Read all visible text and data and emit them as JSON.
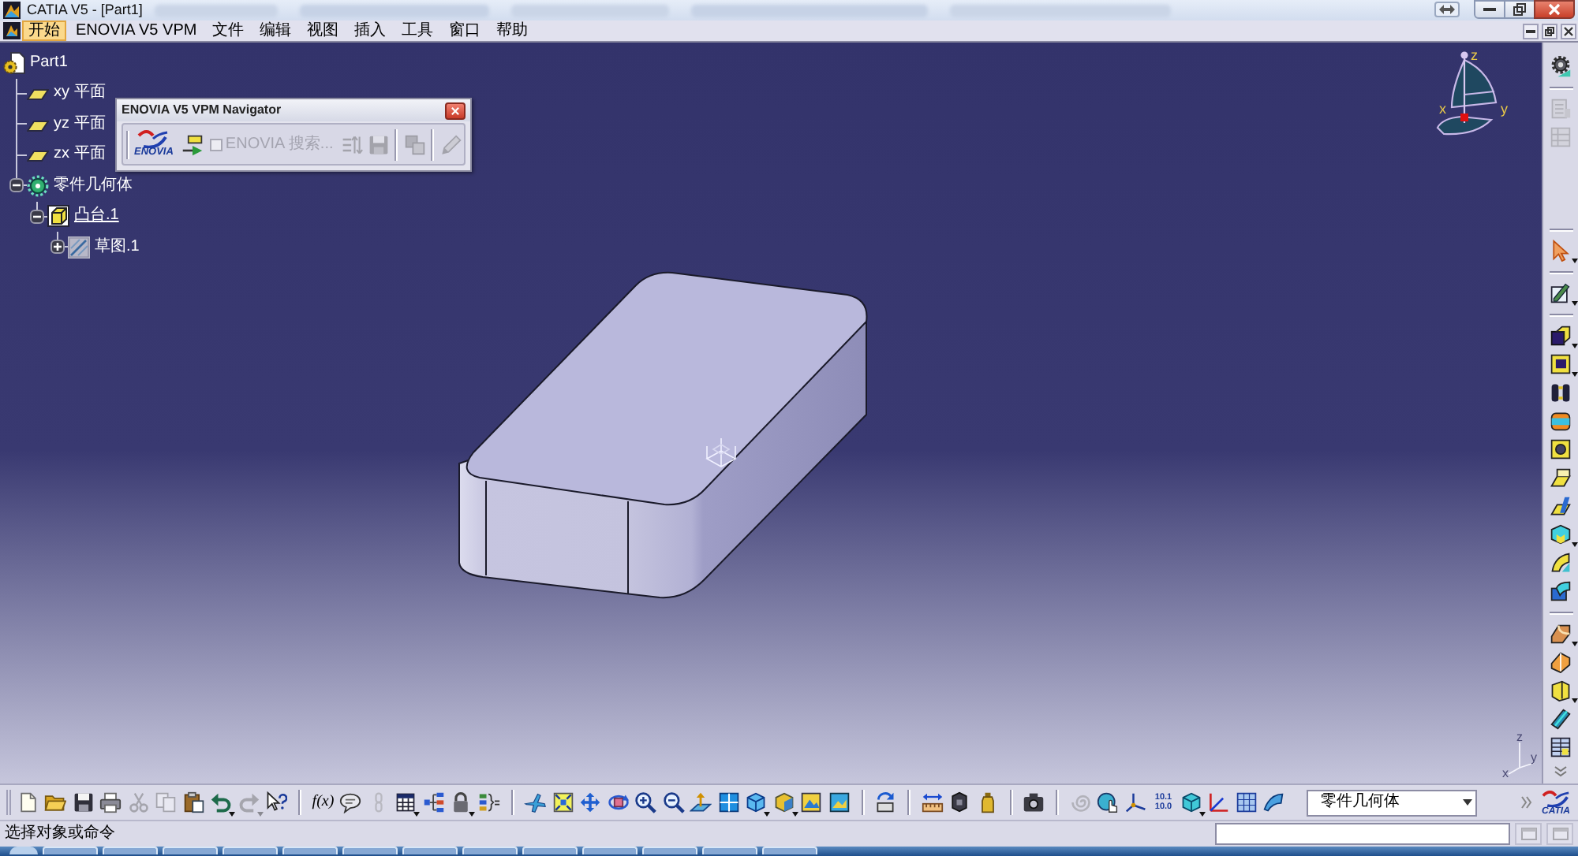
{
  "title_bar": {
    "title": "CATIA V5 - [Part1]"
  },
  "menu_bar": {
    "items": [
      {
        "label": "开始",
        "selected": true
      },
      {
        "label": "ENOVIA V5 VPM",
        "selected": false
      },
      {
        "label": "文件",
        "selected": false
      },
      {
        "label": "编辑",
        "selected": false
      },
      {
        "label": "视图",
        "selected": false
      },
      {
        "label": "插入",
        "selected": false
      },
      {
        "label": "工具",
        "selected": false
      },
      {
        "label": "窗口",
        "selected": false
      },
      {
        "label": "帮助",
        "selected": false
      }
    ]
  },
  "specification_tree": {
    "root": {
      "label": "Part1",
      "kind": "part",
      "in_work": false,
      "children": [
        {
          "label": "xy 平面",
          "kind": "plane",
          "in_work": false
        },
        {
          "label": "yz 平面",
          "kind": "plane",
          "in_work": false
        },
        {
          "label": "zx 平面",
          "kind": "plane",
          "in_work": false
        },
        {
          "label": "零件几何体",
          "kind": "body",
          "in_work": false,
          "expanded": true,
          "children": [
            {
              "label": "凸台.1",
              "kind": "pad",
              "in_work": true,
              "expanded": true,
              "children": [
                {
                  "label": "草图.1",
                  "kind": "sketch",
                  "in_work": false,
                  "expanded": false
                }
              ]
            }
          ]
        }
      ]
    }
  },
  "navigator": {
    "title": "ENOVIA V5 VPM Navigator",
    "logo_text": "ENOVIA",
    "groups": [
      {
        "items": [
          {
            "kind": "connect",
            "disabled": false
          },
          {
            "kind": "checkbox",
            "label": "ENOVIA 搜索...",
            "checked": false,
            "disabled": true
          },
          {
            "kind": "query",
            "disabled": true
          },
          {
            "kind": "store",
            "disabled": true
          }
        ]
      },
      {
        "items": [
          {
            "kind": "compare",
            "disabled": true
          }
        ]
      },
      {
        "items": [
          {
            "kind": "edit",
            "disabled": true
          }
        ]
      }
    ]
  },
  "viewport": {
    "compass": {
      "axes": [
        "z",
        "x",
        "y"
      ]
    },
    "axis_triad": {
      "axes": [
        "z",
        "x",
        "y"
      ]
    }
  },
  "right_toolbar": {
    "toolbars": [
      {
        "groups": [
          {
            "items": [
              {
                "kind": "compass",
                "disabled": false,
                "menu": false
              }
            ]
          },
          {
            "items": [
              {
                "kind": "catalog",
                "disabled": true,
                "menu": false
              },
              {
                "kind": "catalog2",
                "disabled": true,
                "menu": false
              }
            ]
          }
        ]
      },
      {
        "groups": [
          {
            "items": [
              {
                "kind": "select",
                "disabled": false,
                "menu": true
              }
            ]
          },
          {
            "items": [
              {
                "kind": "sketch",
                "disabled": false,
                "menu": true
              }
            ]
          },
          {
            "items": [
              {
                "kind": "pad",
                "disabled": false,
                "menu": true
              },
              {
                "kind": "pocket",
                "disabled": false,
                "menu": true
              },
              {
                "kind": "shaft",
                "disabled": false,
                "menu": false
              },
              {
                "kind": "groove",
                "disabled": false,
                "menu": false
              },
              {
                "kind": "hole",
                "disabled": false,
                "menu": false
              },
              {
                "kind": "rib",
                "disabled": false,
                "menu": false
              },
              {
                "kind": "slot",
                "disabled": false,
                "menu": false
              },
              {
                "kind": "stiffener",
                "disabled": false,
                "menu": true
              },
              {
                "kind": "loft",
                "disabled": false,
                "menu": false
              },
              {
                "kind": "removeloft",
                "disabled": false,
                "menu": false
              }
            ]
          },
          {
            "items": [
              {
                "kind": "fillet",
                "disabled": false,
                "menu": true
              },
              {
                "kind": "draft",
                "disabled": false,
                "menu": false
              },
              {
                "kind": "shell",
                "disabled": false,
                "menu": true
              },
              {
                "kind": "thickness",
                "disabled": false,
                "menu": false
              },
              {
                "kind": "thread",
                "disabled": false,
                "menu": false
              }
            ]
          }
        ]
      }
    ]
  },
  "bottom_toolbar": {
    "groups": [
      {
        "items": [
          {
            "kind": "new",
            "disabled": false,
            "menu": false
          },
          {
            "kind": "open",
            "disabled": false,
            "menu": false
          },
          {
            "kind": "save",
            "disabled": false,
            "menu": false
          },
          {
            "kind": "print",
            "disabled": false,
            "menu": false
          },
          {
            "kind": "cut",
            "disabled": true,
            "menu": false
          },
          {
            "kind": "copy",
            "disabled": true,
            "menu": false
          },
          {
            "kind": "paste",
            "disabled": false,
            "menu": false
          },
          {
            "kind": "undo",
            "disabled": false,
            "menu": true
          },
          {
            "kind": "redo",
            "disabled": true,
            "menu": true
          },
          {
            "kind": "whatsthis",
            "disabled": false,
            "menu": false
          }
        ]
      },
      {
        "items": [
          {
            "kind": "formula",
            "lines": [
              "f(x)"
            ],
            "disabled": false,
            "menu": false
          },
          {
            "kind": "comment",
            "disabled": false,
            "menu": false
          },
          {
            "kind": "link",
            "disabled": true,
            "menu": false
          },
          {
            "kind": "table",
            "disabled": false,
            "menu": true
          },
          {
            "kind": "tree",
            "disabled": false,
            "menu": false
          },
          {
            "kind": "lock",
            "disabled": false,
            "menu": true
          },
          {
            "kind": "parameters",
            "disabled": false,
            "menu": false
          }
        ]
      },
      {
        "items": [
          {
            "kind": "fly",
            "disabled": false,
            "menu": false
          },
          {
            "kind": "fitall",
            "disabled": false,
            "menu": false
          },
          {
            "kind": "pan",
            "disabled": false,
            "menu": false
          },
          {
            "kind": "rotate",
            "disabled": false,
            "menu": false
          },
          {
            "kind": "zoomin",
            "disabled": false,
            "menu": false
          },
          {
            "kind": "zoomout",
            "disabled": false,
            "menu": false
          },
          {
            "kind": "normal",
            "disabled": false,
            "menu": false
          },
          {
            "kind": "views",
            "disabled": false,
            "menu": false
          },
          {
            "kind": "iso",
            "disabled": false,
            "menu": true
          },
          {
            "kind": "shading",
            "disabled": false,
            "menu": true
          },
          {
            "kind": "hideshow",
            "disabled": false,
            "menu": false
          },
          {
            "kind": "swapspace",
            "disabled": false,
            "menu": false
          }
        ]
      },
      {
        "items": [
          {
            "kind": "update",
            "disabled": false,
            "menu": false
          }
        ]
      },
      {
        "items": [
          {
            "kind": "measure",
            "disabled": false,
            "menu": false
          },
          {
            "kind": "inertia",
            "disabled": false,
            "menu": false
          },
          {
            "kind": "material",
            "disabled": false,
            "menu": false
          }
        ]
      },
      {
        "items": [
          {
            "kind": "capture",
            "disabled": false,
            "menu": false
          }
        ]
      },
      {
        "items": [
          {
            "kind": "spiral",
            "disabled": true,
            "menu": false
          },
          {
            "kind": "globehand",
            "disabled": false,
            "menu": false
          },
          {
            "kind": "axis",
            "disabled": false,
            "menu": false
          },
          {
            "kind": "numbers",
            "lines": [
              "10.1",
              "10.0"
            ],
            "disabled": false,
            "menu": false
          },
          {
            "kind": "cube",
            "disabled": false,
            "menu": true
          },
          {
            "kind": "axisred",
            "disabled": false,
            "menu": false
          },
          {
            "kind": "grid",
            "disabled": false,
            "menu": false
          },
          {
            "kind": "sheet",
            "disabled": false,
            "menu": false
          }
        ]
      }
    ],
    "current_body": {
      "value": "零件几何体"
    },
    "logo_text": "CATIA"
  },
  "status_bar": {
    "message": "选择对象或命令",
    "buttons": [
      {
        "disabled": true
      },
      {
        "disabled": true
      }
    ]
  }
}
